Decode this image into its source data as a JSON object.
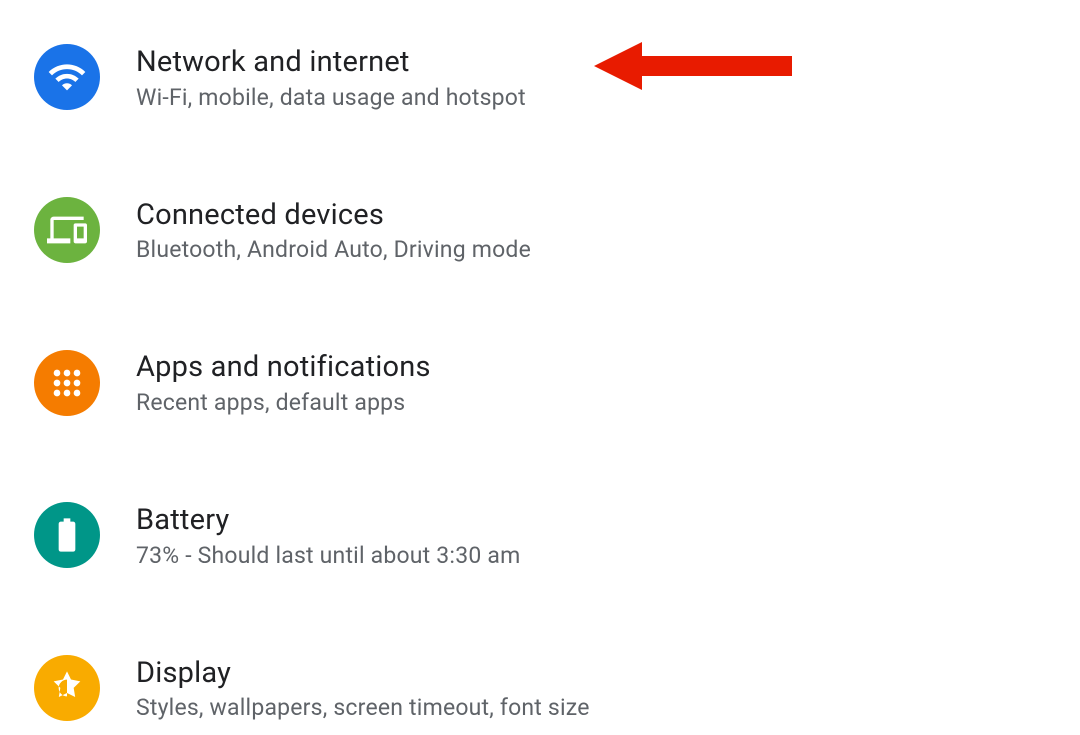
{
  "settings": {
    "items": [
      {
        "title": "Network and internet",
        "subtitle": "Wi-Fi, mobile, data usage and hotspot",
        "icon": "wifi-icon",
        "bgClass": "bg-blue"
      },
      {
        "title": "Connected devices",
        "subtitle": "Bluetooth, Android Auto, Driving mode",
        "icon": "devices-icon",
        "bgClass": "bg-green"
      },
      {
        "title": "Apps and notifications",
        "subtitle": "Recent apps, default apps",
        "icon": "apps-icon",
        "bgClass": "bg-orange"
      },
      {
        "title": "Battery",
        "subtitle": "73% - Should last until about 3:30 am",
        "icon": "battery-icon",
        "bgClass": "bg-teal"
      },
      {
        "title": "Display",
        "subtitle": "Styles, wallpapers, screen timeout, font size",
        "icon": "display-icon",
        "bgClass": "bg-amber"
      }
    ]
  },
  "annotation": {
    "type": "arrow",
    "color": "#e81b00",
    "pointsTo": 0
  }
}
